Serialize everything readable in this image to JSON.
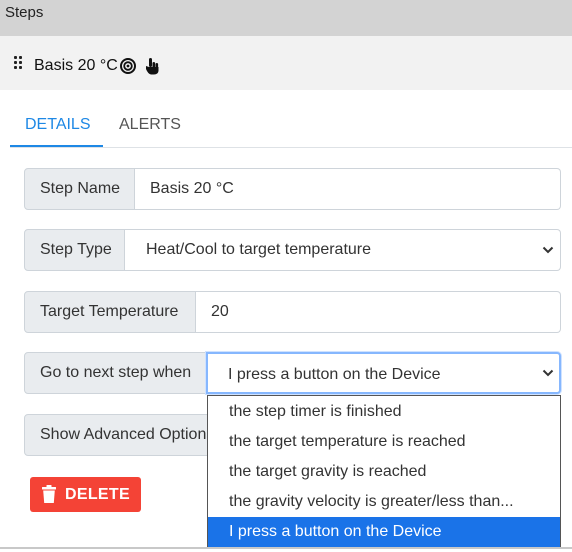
{
  "window": {
    "title": "Steps"
  },
  "step": {
    "title": "Basis 20 °C"
  },
  "icons": {
    "drag": "drag-handle-icon",
    "target": "target-icon",
    "hand": "hand-pointer-icon",
    "chevron": "chevron-down-icon",
    "trash": "trash-icon"
  },
  "tabs": [
    {
      "label": "DETAILS",
      "active": true
    },
    {
      "label": "ALERTS",
      "active": false
    }
  ],
  "form": {
    "step_name": {
      "label": "Step Name",
      "value": "Basis 20 °C"
    },
    "step_type": {
      "label": "Step Type",
      "value": "Heat/Cool to target temperature"
    },
    "target_temperature": {
      "label": "Target Temperature",
      "value": "20"
    },
    "next_step": {
      "label": "Go to next step when",
      "value": "I press a button on the Device",
      "options": [
        "the step timer is finished",
        "the target temperature is reached",
        "the target gravity is reached",
        "the gravity velocity is greater/less than...",
        "I press a button on the Device"
      ],
      "selected_index": 4
    },
    "advanced": {
      "label": "Show Advanced Options"
    }
  },
  "actions": {
    "delete_label": "DELETE"
  },
  "colors": {
    "accent": "#1e88e5",
    "danger": "#f44336",
    "selected_option": "#1a73e8",
    "titlebar": "#d3d3d3"
  }
}
